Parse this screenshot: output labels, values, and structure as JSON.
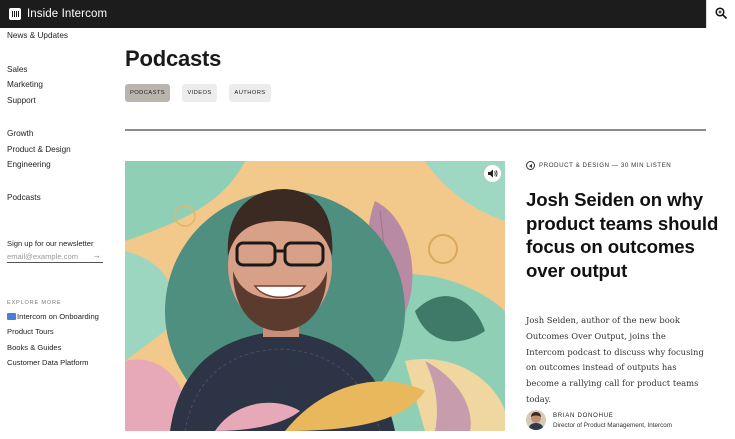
{
  "header": {
    "brand": "Inside Intercom",
    "logo_icon": "intercom-logo-icon",
    "search_icon": "search-icon",
    "bg_color": "#1c1c1c"
  },
  "sidebar": {
    "news": "News & Updates",
    "group1": [
      "Sales",
      "Marketing",
      "Support"
    ],
    "group2": [
      "Growth",
      "Product & Design",
      "Engineering"
    ],
    "podcasts": "Podcasts",
    "newsletter_label": "Sign up for our newsletter",
    "email_placeholder": "email@example.com",
    "email_submit_icon": "arrow-right-icon",
    "explore_heading": "EXPLORE MORE",
    "explore_items": [
      "Intercom on Onboarding",
      "Product Tours",
      "Books & Guides",
      "Customer Data Platform"
    ]
  },
  "main": {
    "title": "Podcasts",
    "tabs": [
      {
        "label": "PODCASTS",
        "active": true
      },
      {
        "label": "VIDEOS",
        "active": false
      },
      {
        "label": "AUTHORS",
        "active": false
      }
    ]
  },
  "article": {
    "audio_icon": "speaker-icon",
    "meta_icon": "play-back-icon",
    "meta": "PRODUCT & DESIGN — 30 MIN LISTEN",
    "headline": "Josh Seiden on why product teams should focus on outcomes over output",
    "excerpt": "Josh Seiden, author of the new book Outcomes Over Output, joins the Intercom podcast to discuss why focusing on outcomes instead of outputs has become a rallying call for product teams today.",
    "author_name": "BRIAN DONOHUE",
    "author_role": "Director of Product Management, Intercom"
  },
  "colors": {
    "active_tab": "#b9b4ae",
    "inactive_tab": "#ececec",
    "hero_bg": "#f2c98a",
    "hero_green": "#8fcfb6"
  }
}
